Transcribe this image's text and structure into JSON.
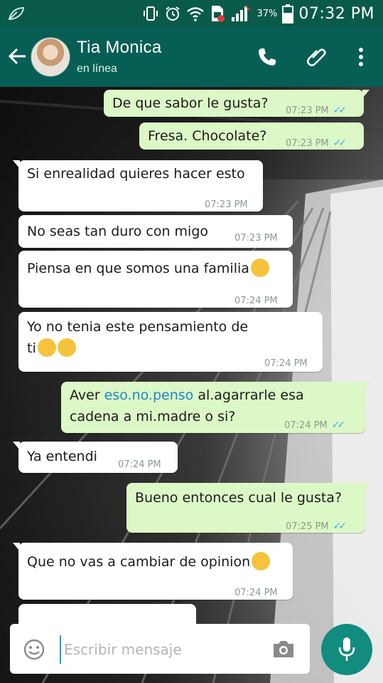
{
  "status_bar": {
    "battery_percent": "37%",
    "time": "07:32 PM",
    "icons": [
      "leaf-icon",
      "phone-vibrate-icon",
      "alarm-icon",
      "wifi-icon",
      "sim-icon",
      "signal-icon",
      "battery-icon"
    ]
  },
  "header": {
    "name": "Tia Monica",
    "status": "en línea",
    "icons": [
      "back-arrow-icon",
      "avatar",
      "call-icon",
      "attach-icon",
      "more-icon"
    ]
  },
  "messages": [
    {
      "dir": "out",
      "text": "De que sabor le gusta?",
      "time": "07:23 PM",
      "ticks": "✓✓"
    },
    {
      "dir": "out",
      "text": "Fresa. Chocolate?",
      "time": "07:23 PM",
      "ticks": "✓✓"
    },
    {
      "dir": "in",
      "text": "Si enrealidad quieres hacer esto",
      "time": "07:23 PM"
    },
    {
      "dir": "in",
      "text": "No seas tan duro con migo",
      "time": "07:23 PM"
    },
    {
      "dir": "in",
      "text": "Piensa en que somos una familia",
      "time": "07:24 PM",
      "emoji": [
        "unamused-face"
      ]
    },
    {
      "dir": "in",
      "text_line1": "Yo no tenia este pensamiento de",
      "text_line2": "ti",
      "time": "07:24 PM",
      "emoji": [
        "unamused-face",
        "disappointed-face"
      ]
    },
    {
      "dir": "out",
      "text_a": "Aver ",
      "text_link": "eso.no.penso",
      "text_b": " al.agarrarle esa",
      "text_line2": "cadena a mi.madre o si?",
      "time": "07:24 PM",
      "ticks": "✓✓"
    },
    {
      "dir": "in",
      "text": "Ya entendi",
      "time": "07:24 PM"
    },
    {
      "dir": "out",
      "text": "Bueno entonces cual le gusta?",
      "time": "07:25 PM",
      "ticks": "✓✓"
    },
    {
      "dir": "in",
      "text": "Que no vas a cambiar de opinion",
      "time": "07:24 PM",
      "emoji": [
        "disappointed-face"
      ]
    }
  ],
  "input": {
    "placeholder": "Escribir mensaje",
    "value": "",
    "icons": [
      "emoji-icon",
      "camera-icon",
      "mic-icon"
    ]
  },
  "colors": {
    "header": "#075e54",
    "status_bar": "#0a5a4a",
    "outgoing_bubble": "#dcf8c6",
    "incoming_bubble": "#ffffff",
    "read_ticks": "#34b7f1",
    "mic_button": "#128c7e"
  }
}
